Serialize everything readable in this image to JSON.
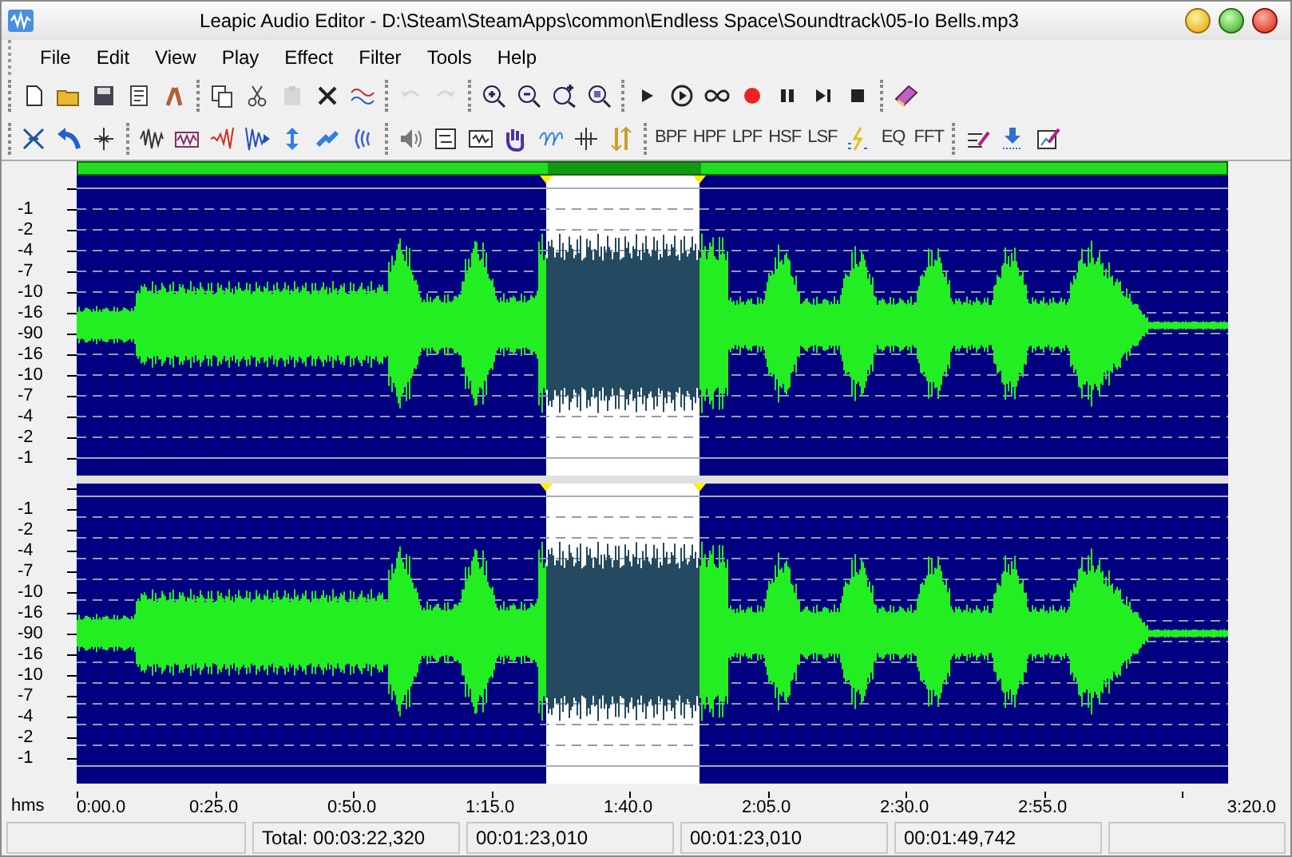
{
  "window": {
    "title": "Leapic Audio Editor - D:\\Steam\\SteamApps\\common\\Endless Space\\Soundtrack\\05-Io Bells.mp3"
  },
  "menu": [
    "File",
    "Edit",
    "View",
    "Play",
    "Effect",
    "Filter",
    "Tools",
    "Help"
  ],
  "toolbar_1": [
    [
      {
        "kind": "icon",
        "disabled": false
      },
      {
        "kind": "icon",
        "disabled": false
      },
      {
        "kind": "icon",
        "disabled": false
      },
      {
        "kind": "icon",
        "disabled": false
      },
      {
        "kind": "icon",
        "disabled": false
      }
    ],
    [
      {
        "kind": "icon",
        "disabled": false
      },
      {
        "kind": "icon",
        "disabled": false
      },
      {
        "kind": "icon",
        "disabled": true
      },
      {
        "kind": "icon",
        "disabled": false
      },
      {
        "kind": "icon",
        "disabled": false
      }
    ],
    [
      {
        "kind": "icon",
        "disabled": true
      },
      {
        "kind": "icon",
        "disabled": true
      }
    ],
    [
      {
        "kind": "icon",
        "disabled": false
      },
      {
        "kind": "icon",
        "disabled": false
      },
      {
        "kind": "icon",
        "disabled": false
      },
      {
        "kind": "icon",
        "disabled": false
      }
    ],
    [
      {
        "kind": "icon",
        "disabled": false
      },
      {
        "kind": "icon",
        "disabled": false
      },
      {
        "kind": "icon",
        "disabled": false
      },
      {
        "kind": "icon",
        "disabled": false
      },
      {
        "kind": "icon",
        "disabled": false
      },
      {
        "kind": "icon",
        "disabled": false
      },
      {
        "kind": "icon",
        "disabled": false
      }
    ],
    [
      {
        "kind": "icon",
        "disabled": false
      }
    ]
  ],
  "toolbar_2": [
    [
      {
        "kind": "icon",
        "disabled": false
      },
      {
        "kind": "icon",
        "disabled": false
      },
      {
        "kind": "icon",
        "disabled": false
      }
    ],
    [
      {
        "kind": "icon",
        "disabled": false
      },
      {
        "kind": "icon",
        "disabled": false
      },
      {
        "kind": "icon",
        "disabled": false
      },
      {
        "kind": "icon",
        "disabled": false
      },
      {
        "kind": "icon",
        "disabled": false
      },
      {
        "kind": "icon",
        "disabled": false
      },
      {
        "kind": "icon",
        "disabled": false
      }
    ],
    [
      {
        "kind": "icon",
        "disabled": false
      },
      {
        "kind": "icon",
        "disabled": false
      },
      {
        "kind": "icon",
        "disabled": false
      },
      {
        "kind": "icon",
        "disabled": false
      },
      {
        "kind": "icon",
        "disabled": false
      },
      {
        "kind": "icon",
        "disabled": false
      },
      {
        "kind": "icon",
        "disabled": false
      }
    ],
    [
      {
        "kind": "text",
        "label": "BPF",
        "disabled": false
      },
      {
        "kind": "text",
        "label": "HPF",
        "disabled": false
      },
      {
        "kind": "text",
        "label": "LPF",
        "disabled": false
      },
      {
        "kind": "text",
        "label": "HSF",
        "disabled": false
      },
      {
        "kind": "text",
        "label": "LSF",
        "disabled": false
      },
      {
        "kind": "icon",
        "disabled": false
      },
      {
        "kind": "text",
        "label": "EQ",
        "disabled": false
      },
      {
        "kind": "text",
        "label": "FFT",
        "disabled": false
      }
    ],
    [
      {
        "kind": "icon",
        "disabled": false
      },
      {
        "kind": "icon",
        "disabled": false
      },
      {
        "kind": "icon",
        "disabled": false
      }
    ]
  ],
  "channels": [
    {
      "scale": [
        "-1",
        "-2",
        "-4",
        "-7",
        "-10",
        "-16",
        "-90",
        "-16",
        "-10",
        "-7",
        "-4",
        "-2",
        "-1"
      ]
    },
    {
      "scale": [
        "-1",
        "-2",
        "-4",
        "-7",
        "-10",
        "-16",
        "-90",
        "-16",
        "-10",
        "-7",
        "-4",
        "-2",
        "-1"
      ]
    }
  ],
  "timeline": {
    "unit": "hms",
    "ticks": [
      "0:00.0",
      "0:25.0",
      "0:50.0",
      "1:15.0",
      "1:40.0",
      "2:05.0",
      "2:30.0",
      "2:55.0",
      "3:20.0"
    ]
  },
  "status_bar": [
    "Total: 00:03:22,320",
    "00:01:23,010",
    "00:01:23,010",
    "00:01:49,742"
  ]
}
